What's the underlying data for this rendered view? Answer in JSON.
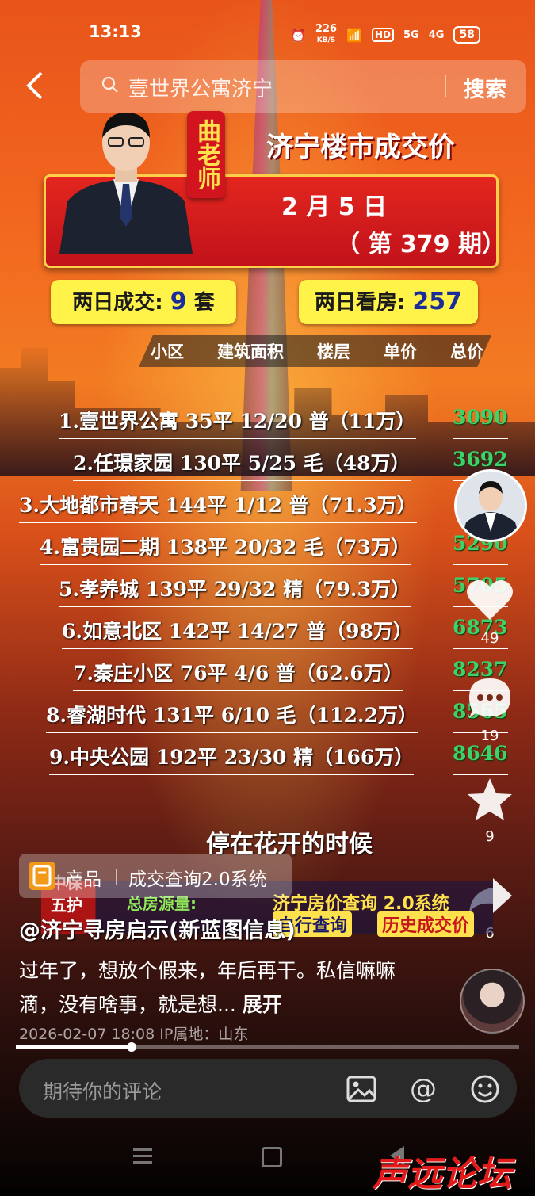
{
  "status_bar": {
    "time": "13:13",
    "net_speed": "226",
    "net_unit": "KB/S",
    "hd": "HD",
    "sig1": "5G",
    "sig2": "4G",
    "battery": "58"
  },
  "search": {
    "query": "壹世界公寓济宁",
    "button": "搜索"
  },
  "poster": {
    "teacher": "曲老师",
    "title": "济宁楼市成交价",
    "date": "2 月 5 日",
    "issue": "（ 第 379 期）",
    "deals_label": "两日成交:",
    "deals_value": "9",
    "deals_unit": "套",
    "views_label": "两日看房:",
    "views_value": "257",
    "columns": [
      "小区",
      "建筑面积",
      "楼层",
      "单价",
      "总价"
    ],
    "rows": [
      {
        "text": "1.壹世界公寓  35平  12/20  普（11万）",
        "price": "3090"
      },
      {
        "text": "2.任璟家园  130平  5/25  毛（48万）",
        "price": "3692"
      },
      {
        "text": "3.大地都市春天  144平  1/12  普（71.3万）",
        "price": ""
      },
      {
        "text": "4.富贵园二期  138平  20/32  毛（73万）",
        "price": "5290"
      },
      {
        "text": "5.孝养城  139平  29/32  精（79.3万）",
        "price": "5705"
      },
      {
        "text": "6.如意北区  142平  14/27  普（98万）",
        "price": "6873"
      },
      {
        "text": "7.秦庄小区  76平  4/6  普（62.6万）",
        "price": "8237"
      },
      {
        "text": "8.睿湖时代  131平  6/10  毛（112.2万）",
        "price": "8565"
      },
      {
        "text": "9.中央公园  192平  23/30  精（166万）",
        "price": "8646"
      }
    ]
  },
  "actions": {
    "like_count": "49",
    "comment_count": "19",
    "favorite_count": "9",
    "share_count": "6"
  },
  "music_title": "停在花开的时候",
  "product": {
    "label": "产品",
    "name": "成交查询2.0系统"
  },
  "promo": {
    "left_1": "中保",
    "left_2": "五护",
    "total_label": "总房源量:",
    "query_system": "济宁房价查询 2.0系统",
    "btn_a": "自行查询",
    "btn_b": "历史成交价"
  },
  "post": {
    "author": "@济宁寻房启示(新蓝图信息)",
    "description": "过年了，想放个假来，年后再干。私信嘛嘛滴，没有啥事，就是想...",
    "expand": "展开",
    "date": "2026-02-07 18:08",
    "location": "IP属地：山东",
    "progress": 0.23
  },
  "comment": {
    "placeholder": "期待你的评论"
  },
  "watermark": "声远论坛"
}
